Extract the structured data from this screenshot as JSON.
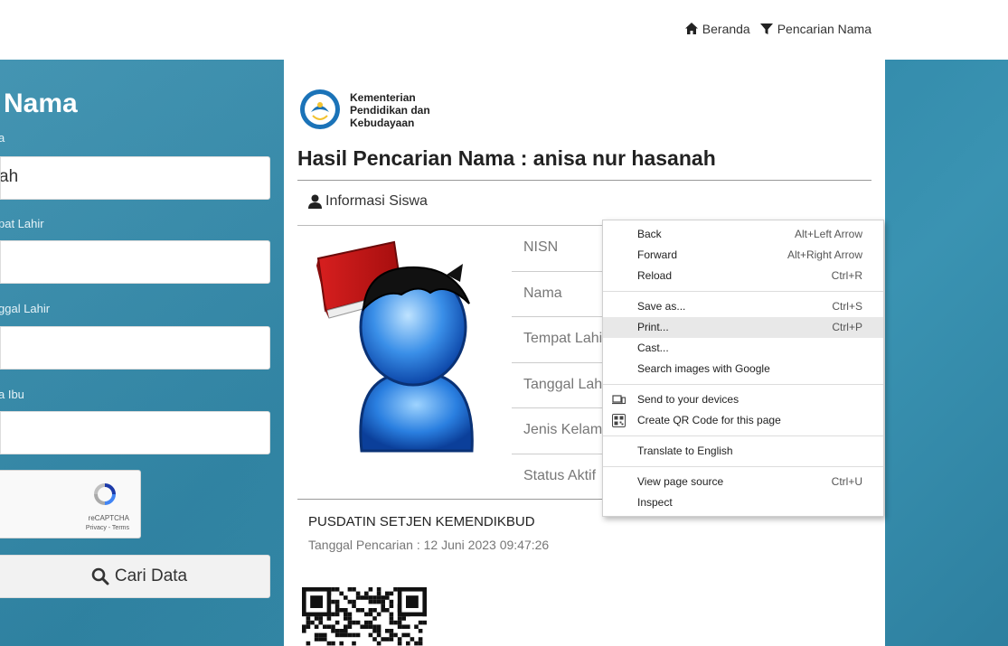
{
  "nav": {
    "home_label": "Beranda",
    "search_label": "Pencarian Nama"
  },
  "search_form": {
    "title": "Nama",
    "fields": [
      {
        "label": "a",
        "value": "ah"
      },
      {
        "label": "pat Lahir",
        "value": ""
      },
      {
        "label": "ggal Lahir",
        "value": ""
      },
      {
        "label": "a Ibu",
        "value": ""
      }
    ],
    "captcha_label": "reCAPTCHA",
    "captcha_links": "Privacy - Terms",
    "submit_label": "Cari Data"
  },
  "result": {
    "ministry_line1": "Kementerian",
    "ministry_line2": "Pendidikan dan",
    "ministry_line3": "Kebudayaan",
    "title": "Hasil Pencarian Nama : anisa nur hasanah",
    "tab_label": "Informasi Siswa",
    "rows": [
      "NISN",
      "Nama",
      "Tempat Lahir",
      "Tanggal Lahir",
      "Jenis Kelamin",
      "Status Aktif"
    ],
    "org": "PUSDATIN SETJEN KEMENDIKBUD",
    "search_date": "Tanggal Pencarian : 12 Juni 2023 09:47:26"
  },
  "context_menu": {
    "items": [
      {
        "label": "Back",
        "shortcut": "Alt+Left Arrow"
      },
      {
        "label": "Forward",
        "shortcut": "Alt+Right Arrow"
      },
      {
        "label": "Reload",
        "shortcut": "Ctrl+R"
      },
      {
        "label": "Save as...",
        "shortcut": "Ctrl+S"
      },
      {
        "label": "Print...",
        "shortcut": "Ctrl+P"
      },
      {
        "label": "Cast...",
        "shortcut": ""
      },
      {
        "label": "Search images with Google",
        "shortcut": ""
      },
      {
        "label": "Send to your devices",
        "shortcut": ""
      },
      {
        "label": "Create QR Code for this page",
        "shortcut": ""
      },
      {
        "label": "Translate to English",
        "shortcut": ""
      },
      {
        "label": "View page source",
        "shortcut": "Ctrl+U"
      },
      {
        "label": "Inspect",
        "shortcut": ""
      }
    ],
    "highlighted": "Print..."
  },
  "colors": {
    "band": "#2f86a7",
    "menu_highlight": "#e8e8e8"
  }
}
